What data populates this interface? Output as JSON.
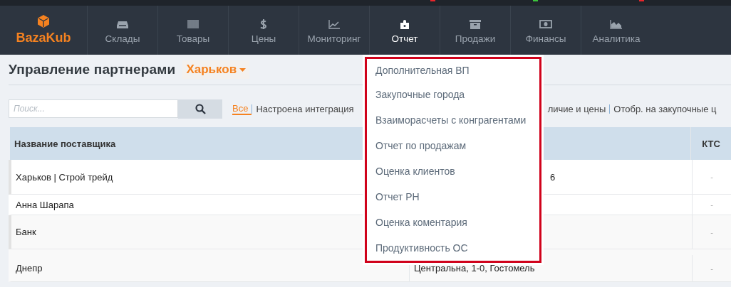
{
  "logo": {
    "text": "BazaKub"
  },
  "top_strip": {
    "marks": [
      {
        "color": "#e8252b"
      },
      {
        "color": "#3cc43c"
      },
      {
        "color": "#e8252b"
      }
    ]
  },
  "nav": [
    {
      "label": "Склады",
      "selected": false
    },
    {
      "label": "Товары",
      "selected": false
    },
    {
      "label": "Цены",
      "selected": false
    },
    {
      "label": "Мониторинг",
      "selected": false
    },
    {
      "label": "Отчет",
      "selected": true
    },
    {
      "label": "Продажи",
      "selected": false
    },
    {
      "label": "Финансы",
      "selected": false
    },
    {
      "label": "Аналитика",
      "selected": false
    }
  ],
  "page": {
    "title": "Управление партнерами",
    "city": "Харьков"
  },
  "search": {
    "placeholder": "Поиск..."
  },
  "filters": [
    {
      "label": "Все",
      "selected": true,
      "after_menu": false
    },
    {
      "label": "Настроена интеграция",
      "selected": false,
      "after_menu": false
    },
    {
      "label": "личие и цены",
      "selected": false,
      "after_menu": true
    },
    {
      "label": "Отобр. на закупочные ц",
      "selected": false,
      "after_menu": false
    }
  ],
  "table": {
    "columns": [
      "Название поставщика",
      "КТС"
    ],
    "rows": [
      {
        "name": "Харьков | Строй трейд",
        "column_2": "6",
        "column_2_cut_start": true,
        "ktc": "-",
        "marked": true
      },
      {
        "name": "Анна Шарапа",
        "ktc": "-",
        "marked": false
      },
      {
        "name": "Банк",
        "ktc": "-",
        "marked": true
      },
      {
        "name": "Днепр",
        "column_2": "Центральна, 1-0, Гостомель",
        "column_2_cut_start": false,
        "ktc": "-",
        "marked": false
      }
    ]
  },
  "dropdown": {
    "items": [
      "Дополнительная ВП",
      "Закупочные города",
      "Взаиморасчеты с конграгентами",
      "Отчет по продажам",
      "Оценка клиентов",
      "Отчет РН",
      "Оценка коментария",
      "Продуктивность ОС"
    ]
  }
}
